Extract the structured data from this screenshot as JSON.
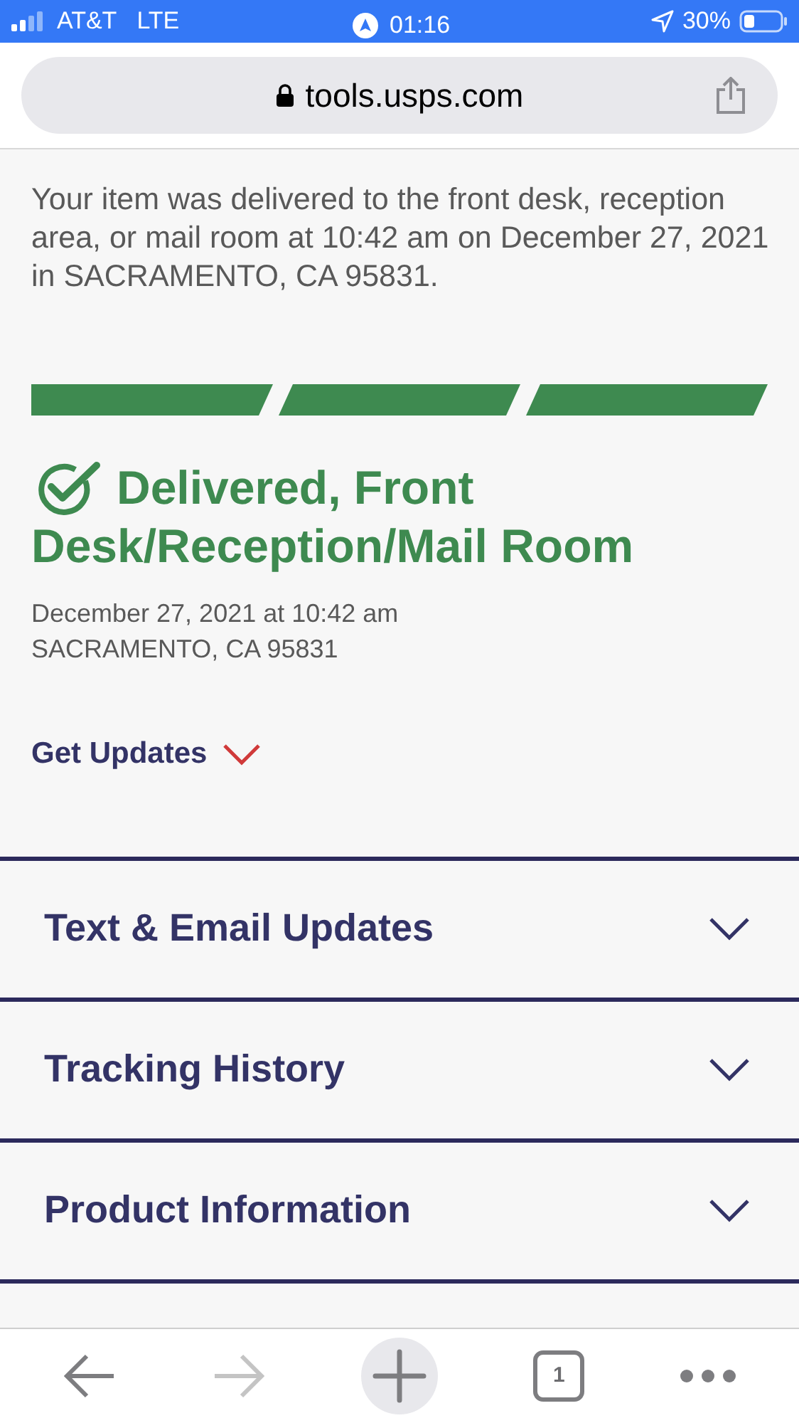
{
  "status_bar": {
    "carrier": "AT&T",
    "network": "LTE",
    "time": "01:16",
    "battery": "30%"
  },
  "browser": {
    "url": "tools.usps.com"
  },
  "summary": "Your item was delivered to the front desk, reception area, or mail room at 10:42 am on December 27, 2021 in SACRAMENTO, CA 95831.",
  "progress_steps": [
    {
      "done": true
    },
    {
      "done": true
    },
    {
      "done": true
    }
  ],
  "status": {
    "title_lines": [
      "Delivered, Front",
      "Desk/Reception/Mail Room"
    ],
    "date": "December 27, 2021 at 10:42 am",
    "location": "SACRAMENTO, CA 95831"
  },
  "get_updates": {
    "label": "Get Updates",
    "expanded": false
  },
  "sections": [
    {
      "title": "Text & Email Updates",
      "expanded": false
    },
    {
      "title": "Tracking History",
      "expanded": false
    },
    {
      "title": "Product Information",
      "expanded": false
    }
  ],
  "toolbar": {
    "back_disabled": false,
    "forward_disabled": true,
    "tab_count": "1"
  }
}
